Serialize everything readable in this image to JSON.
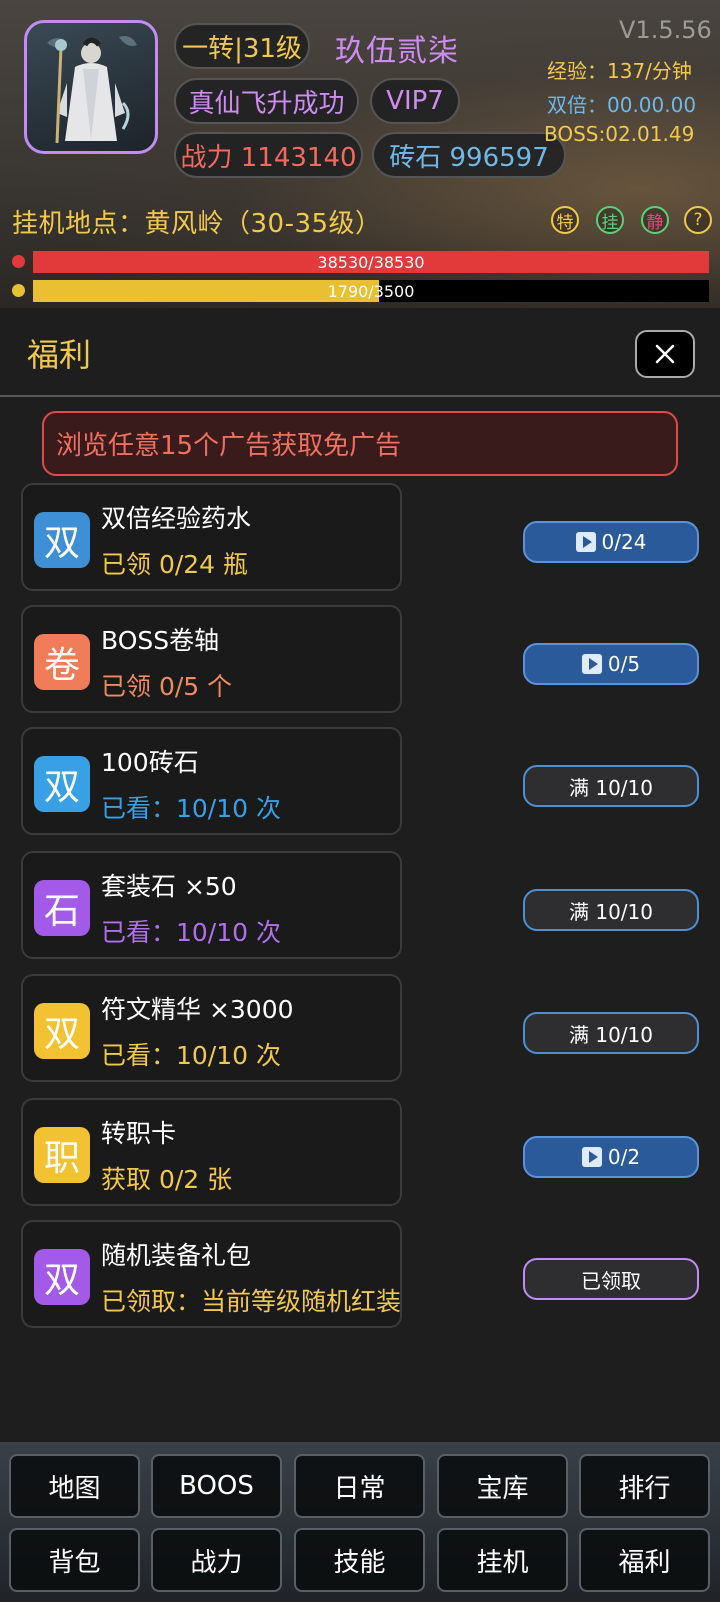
{
  "header": {
    "rank": "一转|31级",
    "name": "玖伍贰柒",
    "title": "真仙飞升成功",
    "vip": "VIP7",
    "power": "战力 1143140",
    "gems": "砖石 996597",
    "version": "V1.5.56",
    "exp_rate": "经验：137/分钟",
    "double": "双倍：00.00.00",
    "boss_timer": "BOSS:02.01.49",
    "location": "挂机地点：黄风岭（30-35级）",
    "badges": [
      "特",
      "挂",
      "静",
      "?"
    ],
    "hp": {
      "text": "38530/38530",
      "fraction": 1.0,
      "color": "#e23a3a"
    },
    "mp": {
      "text": "1790/3500",
      "fraction": 0.5114,
      "color": "#e8c031"
    }
  },
  "panel": {
    "title": "福利",
    "notice": "浏览任意15个广告获取免广告",
    "items": [
      {
        "icon_char": "双",
        "icon_color": "#3f8fd6",
        "title": "双倍经验药水",
        "sub": "已领 0/24 瓶",
        "sub_color": "#f2c94c",
        "action": "0/24",
        "action_type": "play"
      },
      {
        "icon_char": "卷",
        "icon_color": "#f07c5a",
        "title": "BOSS卷轴",
        "sub": "已领 0/5 个",
        "sub_color": "#f08a60",
        "action": "0/5",
        "action_type": "play"
      },
      {
        "icon_char": "双",
        "icon_color": "#3aa0e6",
        "title": "100砖石",
        "sub": "已看：10/10 次",
        "sub_color": "#3aa0e6",
        "action": "满 10/10",
        "action_type": "full"
      },
      {
        "icon_char": "石",
        "icon_color": "#a45ae8",
        "title": "套装石 ×50",
        "sub": "已看：10/10 次",
        "sub_color": "#b070ee",
        "action": "满 10/10",
        "action_type": "full"
      },
      {
        "icon_char": "双",
        "icon_color": "#f2c232",
        "title": "符文精华 ×3000",
        "sub": "已看：10/10 次",
        "sub_color": "#f2c94c",
        "action": "满 10/10",
        "action_type": "full"
      },
      {
        "icon_char": "职",
        "icon_color": "#f2c232",
        "title": "转职卡",
        "sub": "获取 0/2 张",
        "sub_color": "#f2c94c",
        "action": "0/2",
        "action_type": "play"
      },
      {
        "icon_char": "双",
        "icon_color": "#a45ae8",
        "title": "随机装备礼包",
        "sub": "已领取：当前等级随机红装",
        "sub_color": "#f2c94c",
        "action": "已领取",
        "action_type": "done"
      }
    ]
  },
  "nav": {
    "row1": [
      "地图",
      "BOOS",
      "日常",
      "宝库",
      "排行"
    ],
    "row2": [
      "背包",
      "战力",
      "技能",
      "挂机",
      "福利"
    ]
  },
  "icons": {
    "close": "close-icon",
    "play": "play-icon"
  }
}
